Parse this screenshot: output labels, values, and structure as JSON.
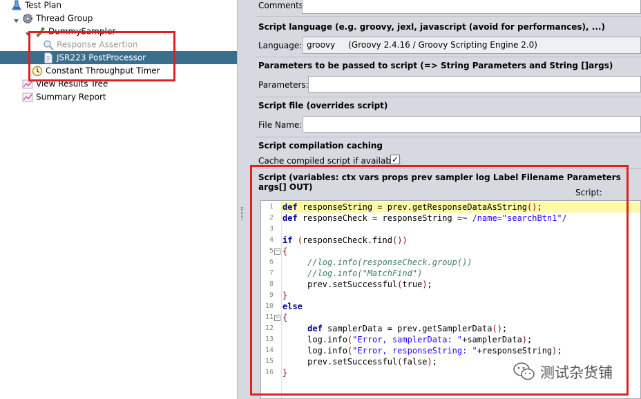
{
  "tree": {
    "items": [
      {
        "label": "Test Plan",
        "icon": "flask-icon"
      },
      {
        "label": "Thread Group",
        "icon": "gear-icon"
      },
      {
        "label": "DummySampler",
        "icon": "pipette-icon"
      },
      {
        "label": "Response Assertion",
        "icon": "magnifier-icon",
        "disabled": true
      },
      {
        "label": "JSR223 PostProcessor",
        "icon": "script-icon",
        "selected": true
      },
      {
        "label": "Constant Throughput Timer",
        "icon": "clock-icon"
      },
      {
        "label": "View Results Tree",
        "icon": "chart-icon"
      },
      {
        "label": "Summary Report",
        "icon": "chart-icon"
      }
    ]
  },
  "panel": {
    "comments_label": "Comments:",
    "language_section": "Script language (e.g. groovy, jexl, javascript (avoid for performances), ...)",
    "language_label": "Language:",
    "language_value": "groovy     (Groovy 2.4.16 / Groovy Scripting Engine 2.0)",
    "params_section": "Parameters to be passed to script (=> String Parameters and String []args)",
    "params_label": "Parameters:",
    "file_section": "Script file (overrides script)",
    "file_label": "File Name:",
    "caching_section": "Script compilation caching",
    "cache_label": "Cache compiled script if available:",
    "cache_checked": true,
    "cache_check_glyph": "✓",
    "script_section": "Script (variables: ctx vars props prev sampler log Label Filename Parameters args[] OUT)",
    "script_header": "Script:"
  },
  "editor": {
    "highlighted_line": 1,
    "fold_markers": [
      5,
      11
    ],
    "fold_glyph": "−",
    "lines": [
      "def responseString = prev.getResponseDataAsString();",
      "def responseCheck = responseString =~ /name=\"searchBtn1\"/",
      "",
      "if (responseCheck.find())",
      "{",
      "     //log.info(responseCheck.group())",
      "     //log.info(\"MatchFind\")",
      "     prev.setSuccessful(true);",
      "}",
      "else",
      "{",
      "     def samplerData = prev.getSamplerData();",
      "     log.info(\"Error, samplerData: \"+samplerData);",
      "     log.info(\"Error, responseString: \"+responseString);",
      "     prev.setSuccessful(false);",
      "}"
    ]
  },
  "watermark": {
    "text": "测试杂货铺"
  },
  "colors": {
    "selection": "#3a6e8f",
    "annotation": "#e02020",
    "panel_bg": "#d6d9df",
    "highlight": "#fdfba8"
  }
}
